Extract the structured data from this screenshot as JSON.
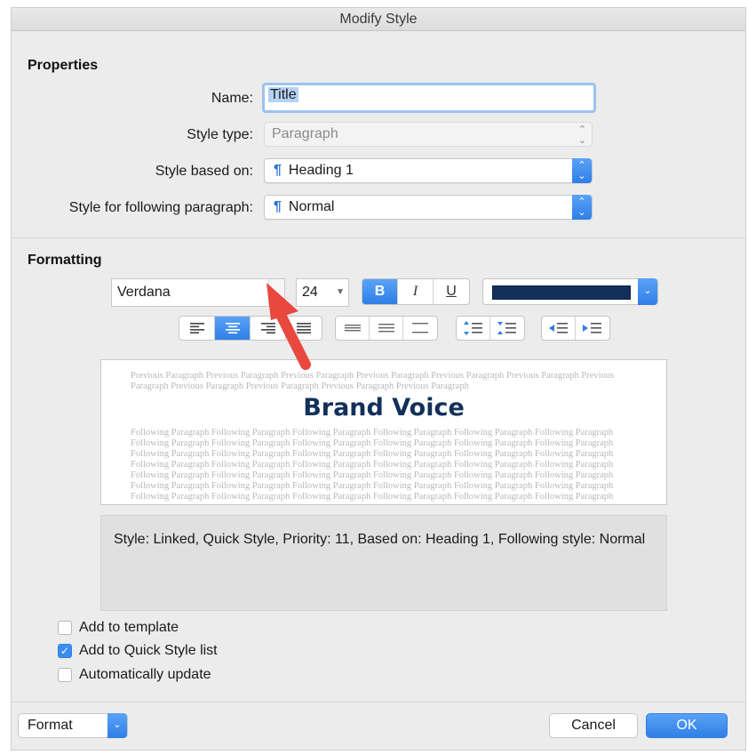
{
  "window": {
    "title": "Modify Style"
  },
  "properties": {
    "heading": "Properties",
    "name_label": "Name:",
    "name_value": "Title",
    "style_type_label": "Style type:",
    "style_type_value": "Paragraph",
    "based_on_label": "Style based on:",
    "based_on_value": "Heading 1",
    "following_label": "Style for following paragraph:",
    "following_value": "Normal",
    "pilcrow": "¶"
  },
  "formatting": {
    "heading": "Formatting",
    "font": "Verdana",
    "size": "24",
    "bold_glyph": "B",
    "italic_glyph": "I",
    "underline_glyph": "U",
    "bold_active": true,
    "alignment_active": "center",
    "font_color": "#13305a"
  },
  "preview": {
    "previous_text": "Previous Paragraph Previous Paragraph Previous Paragraph Previous Paragraph Previous Paragraph Previous Paragraph Previous Paragraph Previous Paragraph Previous Paragraph Previous Paragraph Previous Paragraph",
    "sample": "Brand Voice",
    "following_text": "Following Paragraph Following Paragraph Following Paragraph Following Paragraph Following Paragraph Following Paragraph Following Paragraph Following Paragraph Following Paragraph Following Paragraph Following Paragraph Following Paragraph Following Paragraph Following Paragraph Following Paragraph Following Paragraph Following Paragraph Following Paragraph Following Paragraph Following Paragraph Following Paragraph Following Paragraph Following Paragraph Following Paragraph Following Paragraph Following Paragraph Following Paragraph Following Paragraph Following Paragraph Following Paragraph Following Paragraph Following Paragraph Following Paragraph Following Paragraph Following Paragraph Following Paragraph Following Paragraph Following Paragraph Following Paragraph Following Paragraph Following Paragraph Following Paragraph Following Paragraph Following Paragraph Following Paragraph Following Paragraph Following Paragraph Following Paragraph Following Paragraph Following Paragraph Following Paragraph Following Paragraph Following Paragraph Following Paragraph Following Paragraph Following Paragraph Following Paragraph Following Paragraph Following Paragraph Following Paragraph Following Paragraph"
  },
  "description": "Style: Linked, Quick Style, Priority: 11, Based on: Heading 1, Following style: Normal",
  "options": {
    "add_to_template": {
      "label": "Add to template",
      "checked": false
    },
    "add_to_quick_style": {
      "label": "Add to Quick Style list",
      "checked": true
    },
    "auto_update": {
      "label": "Automatically update",
      "checked": false
    }
  },
  "footer": {
    "format_label": "Format",
    "cancel_label": "Cancel",
    "ok_label": "OK"
  },
  "icons": {
    "chevron_updown": "⌃⌄",
    "chevron_down": "⌄",
    "checkmark": "✓",
    "callout_arrow": "red-arrow-icon"
  },
  "colors": {
    "accent": "#2f7fe6",
    "arrow": "#e8483e",
    "sample_text": "#13305a"
  }
}
